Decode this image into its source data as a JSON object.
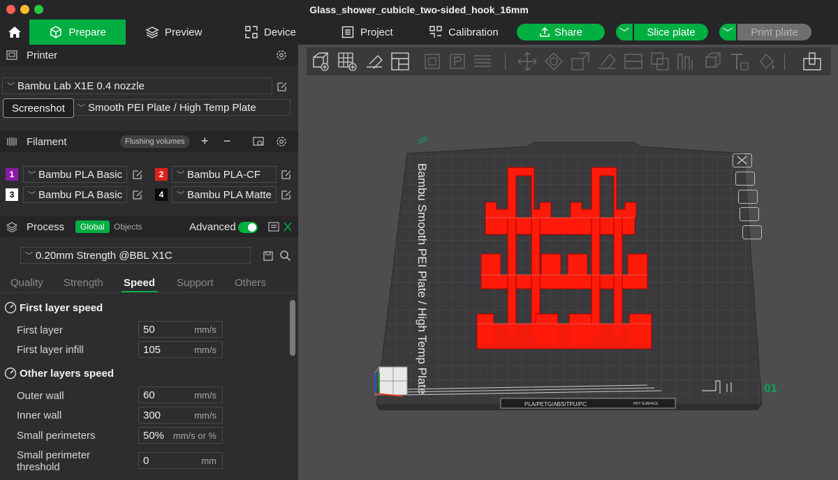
{
  "window": {
    "title": "Glass_shower_cubicle_two-sided_hook_16mm"
  },
  "nav": {
    "prepare": "Prepare",
    "preview": "Preview",
    "device": "Device",
    "project": "Project",
    "calibration": "Calibration",
    "share": "Share",
    "slice": "Slice plate",
    "print": "Print plate"
  },
  "printer": {
    "header": "Printer",
    "model": "Bambu Lab X1E 0.4 nozzle",
    "plate": "Smooth PEI Plate / High Temp Plate",
    "tooltip": "Screenshot"
  },
  "filament": {
    "header": "Filament",
    "flush_label": "Flushing volumes",
    "items": [
      {
        "num": "1",
        "name": "Bambu PLA Basic",
        "color": "#8b1aa6"
      },
      {
        "num": "2",
        "name": "Bambu PLA-CF",
        "color": "#e0201e"
      },
      {
        "num": "3",
        "name": "Bambu PLA Basic",
        "color": "#ffffff"
      },
      {
        "num": "4",
        "name": "Bambu PLA Matte",
        "color": "#0a0a0a"
      }
    ]
  },
  "process": {
    "header": "Process",
    "global": "Global",
    "objects": "Objects",
    "advanced": "Advanced",
    "advanced_on": true,
    "preset": "0.20mm Strength @BBL X1C",
    "tabs": [
      "Quality",
      "Strength",
      "Speed",
      "Support",
      "Others"
    ],
    "active_tab": "Speed"
  },
  "speed": {
    "first_layer_title": "First layer speed",
    "other_layers_title": "Other layers speed",
    "fields": {
      "first_layer": {
        "label": "First layer",
        "value": "50",
        "unit": "mm/s"
      },
      "first_layer_infill": {
        "label": "First layer infill",
        "value": "105",
        "unit": "mm/s"
      },
      "outer_wall": {
        "label": "Outer wall",
        "value": "60",
        "unit": "mm/s"
      },
      "inner_wall": {
        "label": "Inner wall",
        "value": "300",
        "unit": "mm/s"
      },
      "small_perimeters": {
        "label": "Small perimeters",
        "value": "50%",
        "unit": "mm/s or %"
      },
      "small_perimeter_threshold": {
        "label_1": "Small perimeter",
        "label_2": "threshold",
        "value": "0",
        "unit": "mm"
      }
    }
  },
  "plate": {
    "vertical_label": "Bambu Smooth PEI Plate / High Temp Plate",
    "number": "01",
    "bottom_strip": "PLA/PETG/ABS/TPU/PC",
    "hot_surface": "HOT SURFACE",
    "model_color": "#ff1a0a"
  },
  "colors": {
    "accent": "#00ae42",
    "panel": "#2d2d2f",
    "viewport": "#4d4d50"
  }
}
